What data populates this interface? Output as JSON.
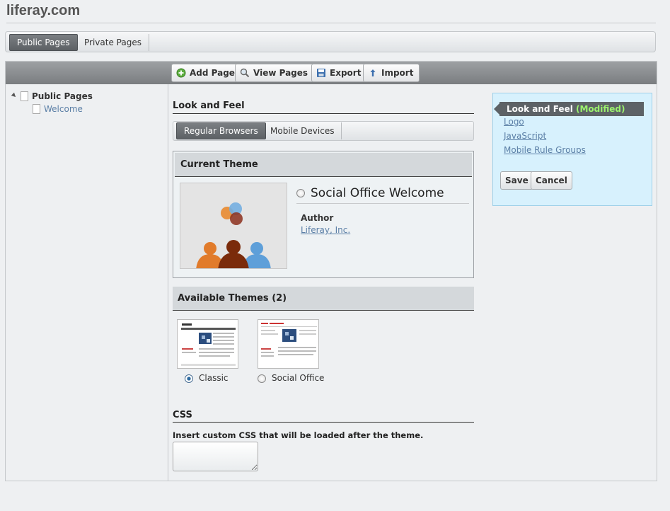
{
  "site": {
    "title": "liferay.com"
  },
  "tabs": {
    "public": "Public Pages",
    "private": "Private Pages"
  },
  "toolbar": {
    "add_page": "Add Page",
    "view_pages": "View Pages",
    "export": "Export",
    "import": "Import"
  },
  "tree": {
    "root": "Public Pages",
    "child": "Welcome"
  },
  "look_and_feel": {
    "title": "Look and Feel",
    "subtabs": {
      "regular": "Regular Browsers",
      "mobile": "Mobile Devices"
    },
    "current_theme": {
      "heading": "Current Theme",
      "name": "Social Office Welcome",
      "author_label": "Author",
      "author": "Liferay, Inc."
    },
    "available": {
      "heading": "Available Themes (2)",
      "themes": [
        {
          "name": "Classic",
          "selected": true
        },
        {
          "name": "Social Office",
          "selected": false
        }
      ]
    },
    "css": {
      "title": "CSS",
      "description": "Insert custom CSS that will be loaded after the theme.",
      "value": ""
    }
  },
  "sidebar": {
    "active": "Look and Feel",
    "modified": "(Modified)",
    "links": [
      "Logo",
      "JavaScript",
      "Mobile Rule Groups"
    ],
    "save": "Save",
    "cancel": "Cancel"
  },
  "colors": {
    "accent": "#5b7fa6",
    "modified": "#9bf36d",
    "side_bg": "#d7f1fd"
  }
}
